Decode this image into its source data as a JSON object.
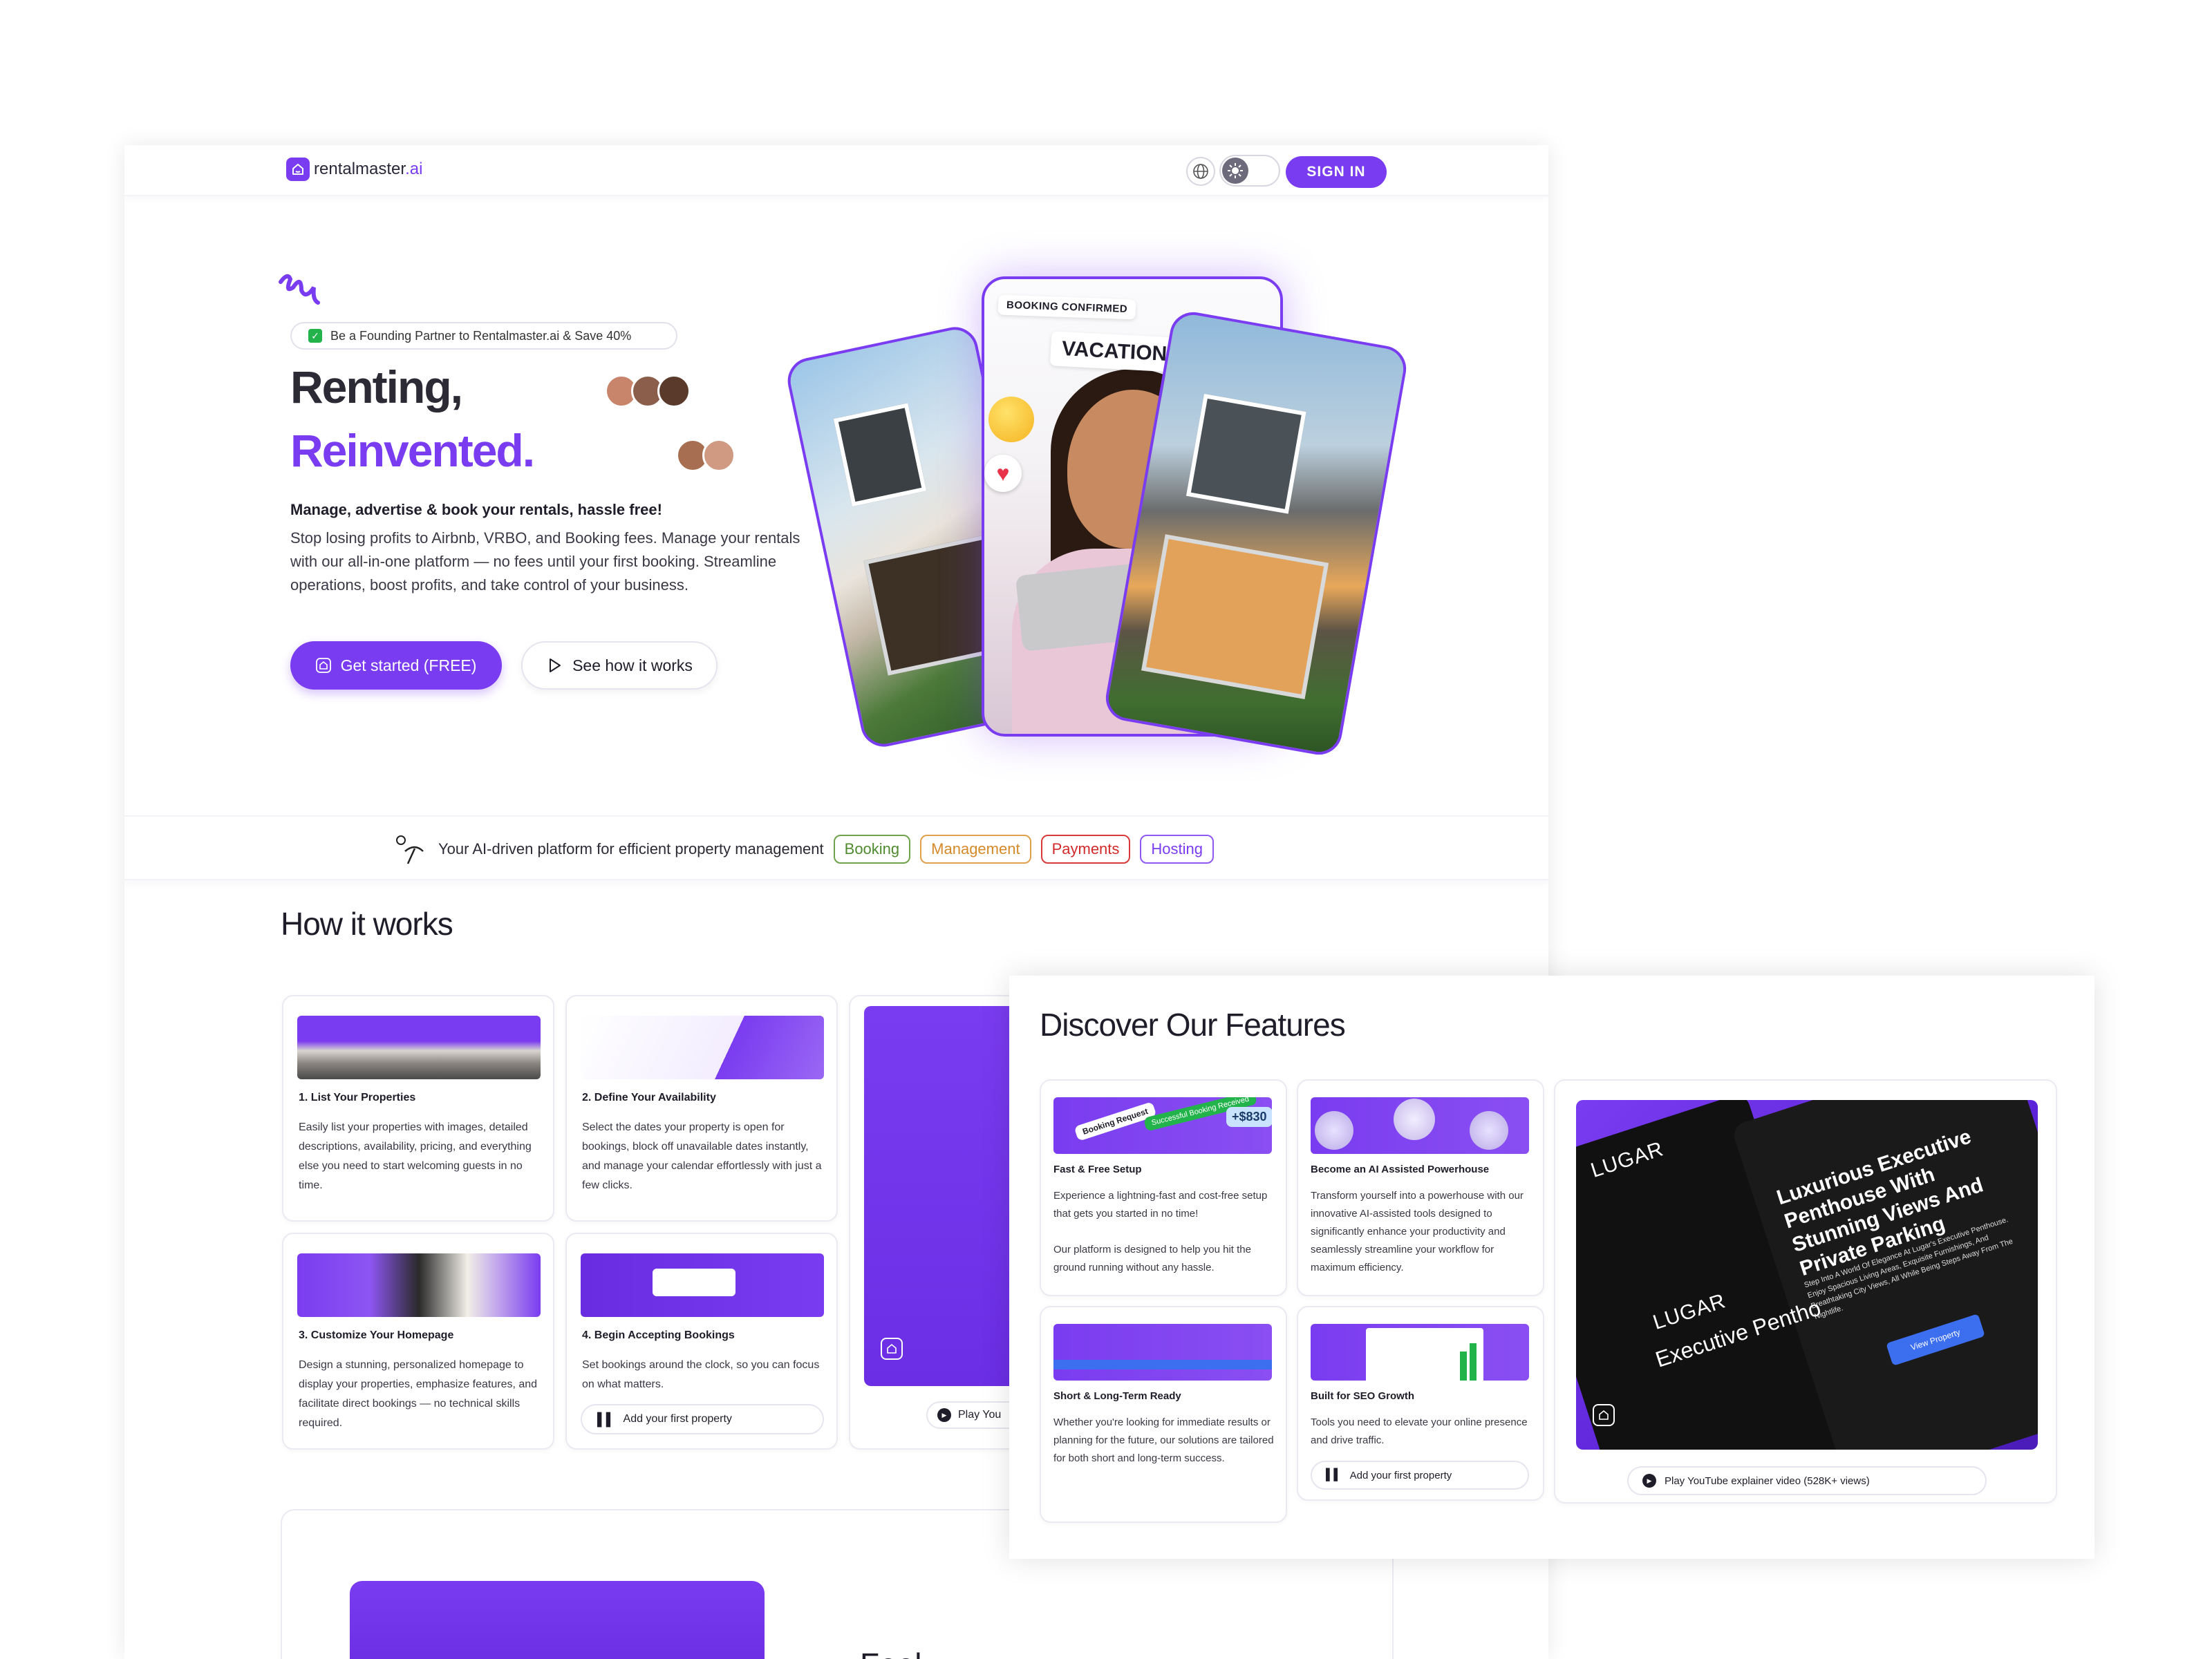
{
  "nav": {
    "brand_main": "rentalmaster",
    "brand_suffix": ".ai",
    "signin_label": "SIGN IN"
  },
  "hero": {
    "partner_badge": "Be a Founding Partner to Rentalmaster.ai & Save 40%",
    "headline_1": "Renting,",
    "headline_2": "Reinvented.",
    "subheading": "Manage, advertise & book your rentals, hassle free!",
    "description": "Stop losing profits to Airbnb, VRBO, and Booking fees. Manage your rentals with our all-in-one platform — no fees until your first booking. Streamline operations, boost profits, and take control of your business.",
    "cta_primary": "Get started (FREE)",
    "cta_secondary": "See how it works",
    "card_tag_1": "BOOKING CONFIRMED",
    "card_tag_2": "VACATION"
  },
  "strip": {
    "text": "Your AI-driven platform for efficient property management",
    "chips": [
      "Booking",
      "Management",
      "Payments",
      "Hosting"
    ]
  },
  "how": {
    "title": "How it works",
    "steps": [
      {
        "title": "1. List Your Properties",
        "desc": "Easily list your properties with images, detailed descriptions, availability, pricing, and everything else you need to start welcoming guests in no time."
      },
      {
        "title": "2. Define Your Availability",
        "desc": "Select the dates your property is open for bookings, block off unavailable dates instantly, and manage your calendar effortlessly with just a few clicks."
      },
      {
        "title": "3. Customize Your Homepage",
        "desc": "Design a stunning, personalized homepage to display your properties, emphasize features, and facilitate direct bookings — no technical skills required."
      },
      {
        "title": "4. Begin Accepting Bookings",
        "desc": "Set bookings around the clock, so you can focus on what matters."
      }
    ],
    "add_property": "Add your first property",
    "play_partial": "Play You",
    "bottom_partial": "Feel"
  },
  "features": {
    "title": "Discover Our Features",
    "items": [
      {
        "title": "Fast & Free Setup",
        "desc": "Experience a lightning-fast and cost-free setup that gets you started in no time!\n\nOur platform is designed to help you hit the ground running without any hassle."
      },
      {
        "title": "Become an AI Assisted Powerhouse",
        "desc": "Transform yourself into a powerhouse with our innovative AI-assisted tools designed to significantly enhance your productivity and seamlessly streamline your workflow for maximum efficiency."
      },
      {
        "title": "Short & Long-Term Ready",
        "desc": "Whether you're looking for immediate results or planning for the future, our solutions are tailored for both short and long-term success."
      },
      {
        "title": "Built for SEO Growth",
        "desc": "Tools you need to elevate your online presence and drive traffic."
      }
    ],
    "feat_img_tag_1": "Booking Request",
    "feat_img_tag_2": "Successful Booking Received",
    "feat_img_tag_3": "+$830",
    "add_property": "Add your first property",
    "video_label": "Play YouTube explainer video (528K+ views)",
    "lugar_logo": "LUGAR",
    "lugar_headline": "Luxurious Executive Penthouse With Stunning Views And Private Parking",
    "lugar_sub": "Step Into A World Of Elegance At Lugar's Executive Penthouse. Enjoy Spacious Living Areas, Exquisite Furnishings, And Breathtaking City Views, All While Being Steps Away From The Nightlife.",
    "lugar_exec": "Executive Pentho",
    "lugar_btn": "View Property"
  },
  "colors": {
    "accent": "#7a3cf0",
    "success": "#22b34b"
  }
}
